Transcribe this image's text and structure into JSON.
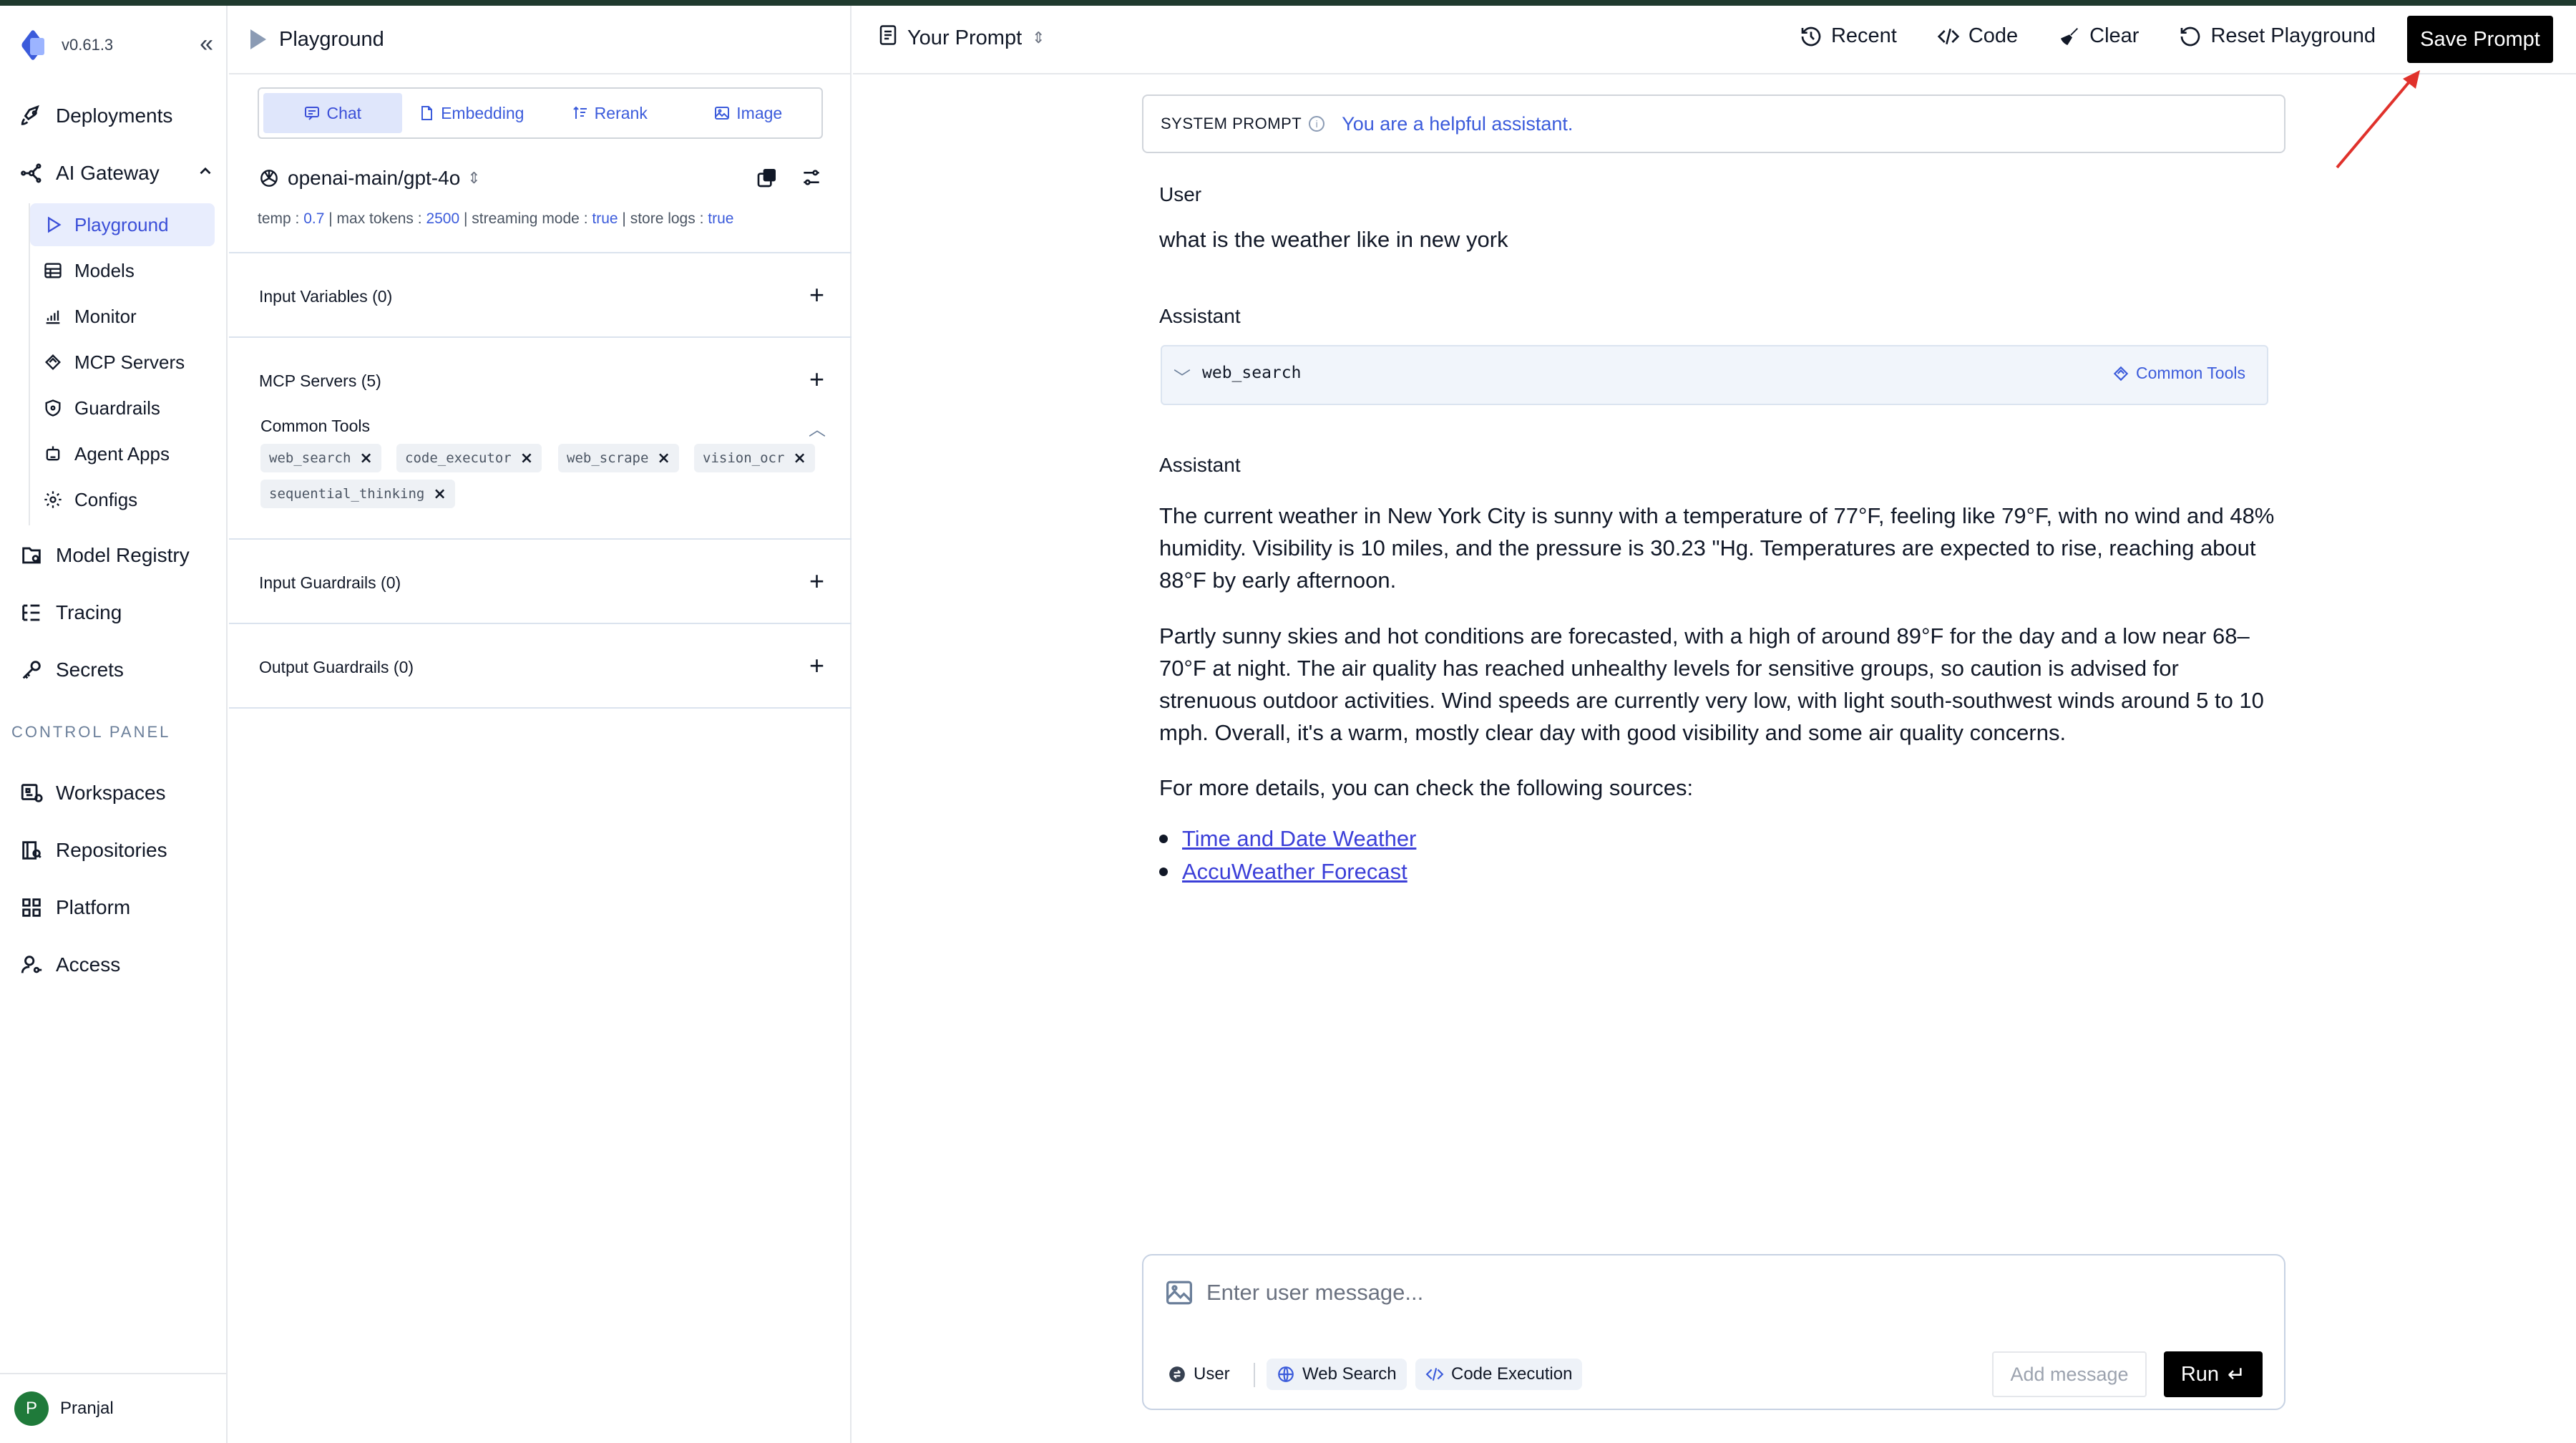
{
  "app": {
    "version": "v0.61.3",
    "accent": "#3b5bdb",
    "icons": {
      "logo": "app-logo-icon",
      "collapse": "double-chevron-left-icon"
    }
  },
  "nav": {
    "items_top": [
      {
        "label": "Deployments",
        "icon": "rocket-icon"
      },
      {
        "label": "AI Gateway",
        "icon": "network-icon",
        "expanded": true
      }
    ],
    "sub_items": [
      {
        "label": "Playground",
        "icon": "play-icon",
        "active": true
      },
      {
        "label": "Models",
        "icon": "table-icon"
      },
      {
        "label": "Monitor",
        "icon": "bar-chart-icon"
      },
      {
        "label": "MCP Servers",
        "icon": "mcp-icon"
      },
      {
        "label": "Guardrails",
        "icon": "shield-icon"
      },
      {
        "label": "Agent Apps",
        "icon": "robot-icon"
      },
      {
        "label": "Configs",
        "icon": "gear-icon"
      }
    ],
    "items_mid": [
      {
        "label": "Model Registry",
        "icon": "registry-icon"
      },
      {
        "label": "Tracing",
        "icon": "tracing-icon"
      },
      {
        "label": "Secrets",
        "icon": "key-icon"
      }
    ],
    "section_label": "CONTROL PANEL",
    "items_bottom": [
      {
        "label": "Workspaces",
        "icon": "workspace-icon"
      },
      {
        "label": "Repositories",
        "icon": "repository-icon"
      },
      {
        "label": "Platform",
        "icon": "grid-icon"
      },
      {
        "label": "Access",
        "icon": "user-key-icon"
      }
    ],
    "user": {
      "initial": "P",
      "name": "Pranjal"
    }
  },
  "config": {
    "title": "Playground",
    "mode_tabs": [
      {
        "label": "Chat",
        "active": true,
        "icon": "chat-icon"
      },
      {
        "label": "Embedding",
        "icon": "document-icon"
      },
      {
        "label": "Rerank",
        "icon": "sort-icon"
      },
      {
        "label": "Image",
        "icon": "image-icon"
      }
    ],
    "model": {
      "name": "openai-main/gpt-4o",
      "icon": "openai-icon"
    },
    "params": [
      {
        "key": "temp",
        "value": "0.7"
      },
      {
        "key": "max tokens",
        "value": "2500"
      },
      {
        "key": "streaming mode",
        "value": "true"
      },
      {
        "key": "store logs",
        "value": "true"
      }
    ],
    "input_variables": "Input Variables (0)",
    "mcp_servers": "MCP Servers (5)",
    "tools_group": "Common Tools",
    "tools": [
      "web_search",
      "code_executor",
      "web_scrape",
      "vision_ocr",
      "sequential_thinking"
    ],
    "input_guardrails": "Input Guardrails (0)",
    "output_guardrails": "Output Guardrails (0)"
  },
  "header": {
    "prompt_selector": "Your Prompt",
    "buttons": [
      {
        "label": "Recent",
        "icon": "history-icon"
      },
      {
        "label": "Code",
        "icon": "code-icon"
      },
      {
        "label": "Clear",
        "icon": "broom-icon"
      },
      {
        "label": "Reset Playground",
        "icon": "reset-icon"
      }
    ],
    "save_label": "Save Prompt"
  },
  "chat": {
    "system_label": "SYSTEM PROMPT",
    "system_text": "You are a helpful assistant.",
    "user_role": "User",
    "user_message": "what is the weather like in new york",
    "assistant_role": "Assistant",
    "tool_call": {
      "name": "web_search",
      "source": "Common Tools"
    },
    "answer_role": "Assistant",
    "paragraphs": [
      "The current weather in New York City is sunny with a temperature of 77°F, feeling like 79°F, with no wind and 48% humidity. Visibility is 10 miles, and the pressure is 30.23 \"Hg. Temperatures are expected to rise, reaching about 88°F by early afternoon.",
      "Partly sunny skies and hot conditions are forecasted, with a high of around 89°F for the day and a low near 68–70°F at night. The air quality has reached unhealthy levels for sensitive groups, so caution is advised for strenuous outdoor activities. Wind speeds are currently very low, with light south-southwest winds around 5 to 10 mph. Overall, it's a warm, mostly clear day with good visibility and some air quality concerns.",
      "For more details, you can check the following sources:"
    ],
    "links": [
      "Time and Date Weather",
      "AccuWeather Forecast"
    ]
  },
  "composer": {
    "placeholder": "Enter user message...",
    "role_pill": "User",
    "web_search": "Web Search",
    "code_execution": "Code Execution",
    "add_message": "Add message",
    "run": "Run"
  }
}
